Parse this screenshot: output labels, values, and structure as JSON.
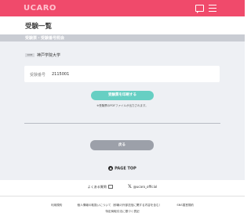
{
  "header": {
    "logo": "UCARO",
    "chat_icon": "chat-icon",
    "menu_icon": "menu-icon",
    "brand_color": "#f04a6b"
  },
  "page": {
    "title": "受験一覧",
    "section": "受験票・受験番号照会"
  },
  "exam": {
    "university_logo_text": "KOBE",
    "university_name": "神戸学院大学",
    "field_label": "受験番号",
    "field_value": "2115001"
  },
  "actions": {
    "confirm_label": "受験票を印刷する",
    "note": "※受験票のPDFファイルが出力されます。",
    "back_label": "戻る",
    "accent_color": "#66cfc3"
  },
  "pagetop": {
    "label": "PAGE TOP"
  },
  "links": {
    "faq": "よくある質問",
    "x_account": "@ucaro_official"
  },
  "footer": {
    "terms": "利用規約",
    "privacy": "個人情報の取扱いについて（即報の外部送信に関する内容を含む）",
    "sns": "SNS運営規約",
    "commerce": "特定商取引法に基づく表記"
  }
}
